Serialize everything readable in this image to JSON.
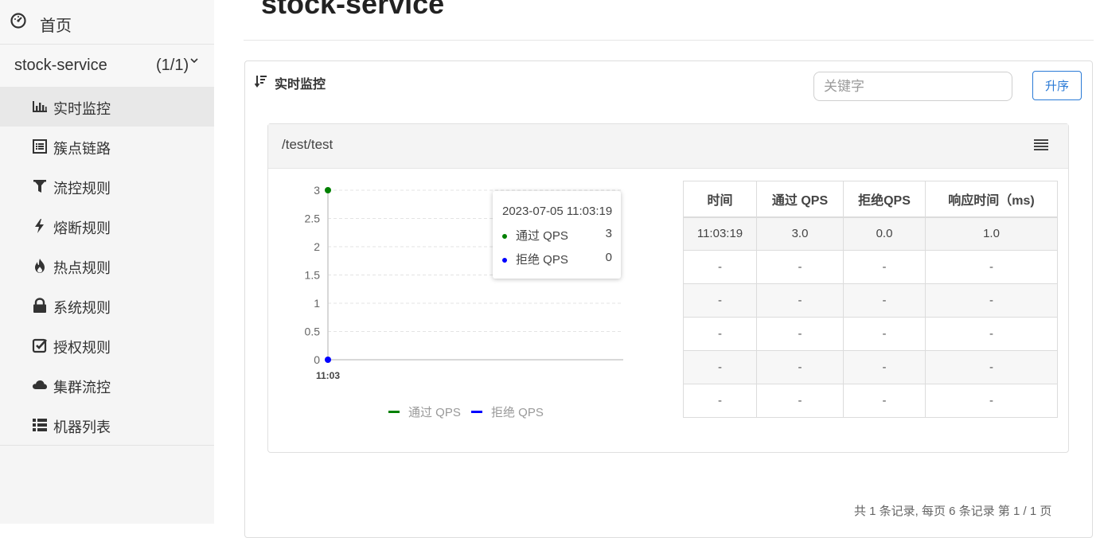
{
  "sidebar": {
    "home_label": "首页",
    "app": {
      "name": "stock-service",
      "count": "(1/1)"
    },
    "items": [
      {
        "label": "实时监控",
        "icon": "bar-chart-icon",
        "active": true
      },
      {
        "label": "簇点链路",
        "icon": "list-icon",
        "active": false
      },
      {
        "label": "流控规则",
        "icon": "filter-icon",
        "active": false
      },
      {
        "label": "熔断规则",
        "icon": "lightning-icon",
        "active": false
      },
      {
        "label": "热点规则",
        "icon": "fire-icon",
        "active": false
      },
      {
        "label": "系统规则",
        "icon": "lock-icon",
        "active": false
      },
      {
        "label": "授权规则",
        "icon": "check-square-icon",
        "active": false
      },
      {
        "label": "集群流控",
        "icon": "cloud-icon",
        "active": false
      },
      {
        "label": "机器列表",
        "icon": "th-list-icon",
        "active": false
      }
    ]
  },
  "header": {
    "title": "stock-service"
  },
  "panel": {
    "title": "实时监控",
    "search_placeholder": "关键字",
    "sort_button": "升序"
  },
  "card": {
    "resource": "/test/test"
  },
  "chart_data": {
    "type": "line",
    "x": [
      "11:03"
    ],
    "series": [
      {
        "name": "通过 QPS",
        "values": [
          3
        ],
        "color": "#008000"
      },
      {
        "name": "拒绝 QPS",
        "values": [
          0
        ],
        "color": "#0000ff"
      }
    ],
    "y_ticks": [
      "0",
      "0.5",
      "1",
      "1.5",
      "2",
      "2.5",
      "3"
    ],
    "ylim": [
      0,
      3
    ],
    "grid": true,
    "legend_position": "bottom"
  },
  "tooltip": {
    "time": "2023-07-05 11:03:19",
    "rows": [
      {
        "name": "通过 QPS",
        "value": "3",
        "color": "#008000"
      },
      {
        "name": "拒绝 QPS",
        "value": "0",
        "color": "#0000ff"
      }
    ]
  },
  "table": {
    "headers": [
      "时间",
      "通过 QPS",
      "拒绝QPS",
      "响应时间（ms)"
    ],
    "rows": [
      [
        "11:03:19",
        "3.0",
        "0.0",
        "1.0"
      ],
      [
        "-",
        "-",
        "-",
        "-"
      ],
      [
        "-",
        "-",
        "-",
        "-"
      ],
      [
        "-",
        "-",
        "-",
        "-"
      ],
      [
        "-",
        "-",
        "-",
        "-"
      ],
      [
        "-",
        "-",
        "-",
        "-"
      ]
    ]
  },
  "pager": {
    "text": "共 1 条记录, 每页 6 条记录 第 1 / 1 页"
  }
}
